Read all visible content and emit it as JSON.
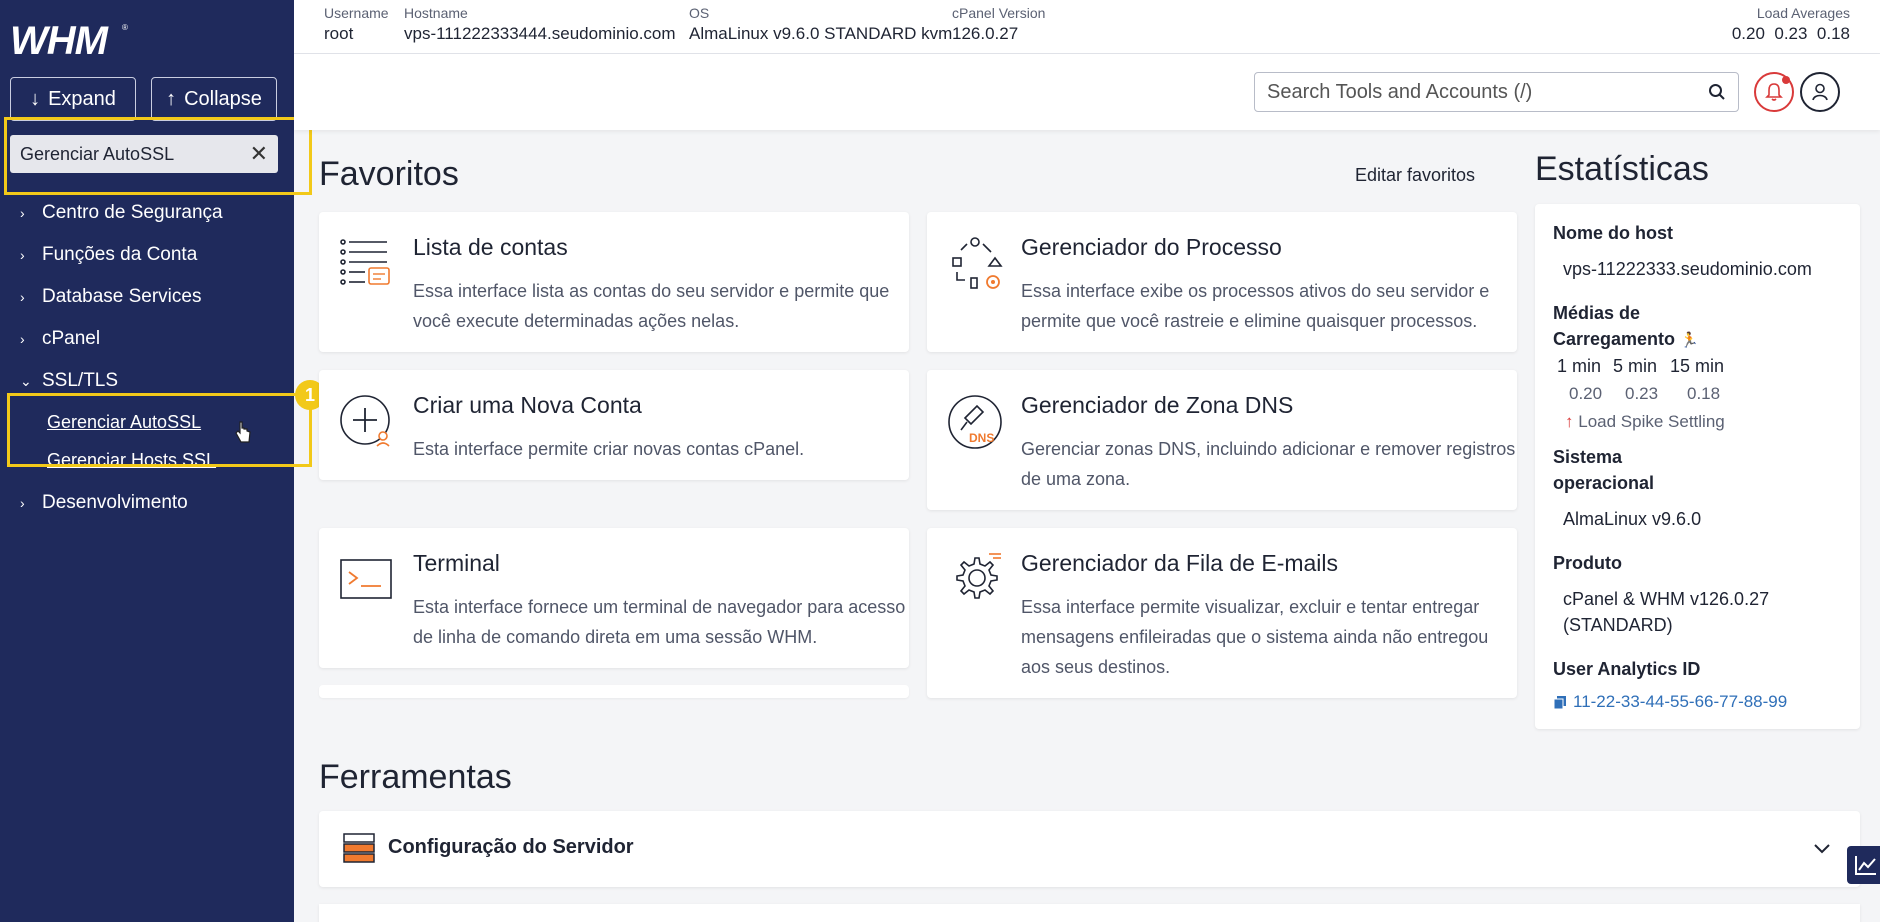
{
  "sidebar": {
    "expand_label": "Expand",
    "collapse_label": "Collapse",
    "search_value": "Gerenciar AutoSSL",
    "step_number": "1",
    "nav": [
      {
        "label": "Centro de Segurança"
      },
      {
        "label": "Funções da Conta"
      },
      {
        "label": "Database Services"
      },
      {
        "label": "cPanel"
      },
      {
        "label": "SSL/TLS"
      },
      {
        "label": "Desenvolvimento"
      }
    ],
    "ssl_sub": [
      {
        "label": "Gerenciar AutoSSL"
      },
      {
        "label": "Gerenciar Hosts SSL"
      }
    ]
  },
  "topinfo": {
    "username_label": "Username",
    "username": "root",
    "hostname_label": "Hostname",
    "hostname": "vps-111222333444.seudominio.com",
    "os_label": "OS",
    "os": "AlmaLinux v9.6.0 STANDARD kvm",
    "cpanel_label": "cPanel Version",
    "cpanel": "126.0.27",
    "load_label": "Load Averages",
    "load": "0.20  0.23  0.18"
  },
  "header": {
    "search_placeholder": "Search Tools and Accounts (/)"
  },
  "favorites": {
    "title": "Favoritos",
    "edit_label": "Editar favoritos",
    "cards": [
      {
        "title": "Lista de contas",
        "desc": "Essa interface lista as contas do seu servidor e permite que você execute determinadas ações nelas."
      },
      {
        "title": "Gerenciador do Processo",
        "desc": "Essa interface exibe os processos ativos do seu servidor e permite que você rastreie e elimine quaisquer processos."
      },
      {
        "title": "Criar uma Nova Conta",
        "desc": "Esta interface permite criar novas contas cPanel."
      },
      {
        "title": "Gerenciador de Zona DNS",
        "desc": "Gerenciar zonas DNS, incluindo adicionar e remover registros de uma zona."
      },
      {
        "title": "Terminal",
        "desc": "Esta interface fornece um terminal de navegador para acesso de linha de comando direta em uma sessão WHM."
      },
      {
        "title": "Gerenciador da Fila de E-mails",
        "desc": "Essa interface permite visualizar, excluir e tentar entregar mensagens enfileiradas que o sistema ainda não entregou aos seus destinos."
      }
    ]
  },
  "stats": {
    "title": "Estatísticas",
    "hostname_label": "Nome do host",
    "hostname": "vps-11222333.seudominio.com",
    "load_label": "Médias de Carregamento",
    "load_headers": [
      "1 min",
      "5 min",
      "15 min"
    ],
    "load_values": [
      "0.20",
      "0.23",
      "0.18"
    ],
    "load_note": "Load Spike Settling",
    "os_label": "Sistema operacional",
    "os": "AlmaLinux v9.6.0",
    "product_label": "Produto",
    "product": "cPanel & WHM v126.0.27 (STANDARD)",
    "uaid_label": "User Analytics ID",
    "uaid": "11-22-33-44-55-66-77-88-99"
  },
  "tools": {
    "title": "Ferramentas",
    "first_group": "Configuração do Servidor"
  },
  "colors": {
    "sidebar_bg": "#1f2a5c",
    "highlight": "#f2c919",
    "accent_orange": "#f07a2f",
    "alert_red": "#d93a3a"
  }
}
